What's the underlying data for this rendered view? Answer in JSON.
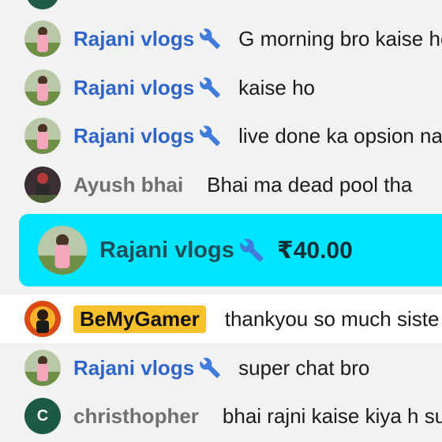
{
  "colors": {
    "member_name": "#2f64c8",
    "superchat_bg": "#00e5ff",
    "badge_bg": "#f7c12c",
    "avatar_letter_bg": "#1c5a44"
  },
  "icons": {
    "moderator": "wrench-icon"
  },
  "messages": [
    {
      "author": "Rajani vlogs",
      "text": "G morning bro kaise ho"
    },
    {
      "author": "Rajani vlogs",
      "text": "kaise ho"
    },
    {
      "author": "Rajani vlogs",
      "text": "live done ka opsion na"
    },
    {
      "author": "Ayush bhai",
      "text": "Bhai ma dead pool tha"
    }
  ],
  "superchat": {
    "author": "Rajani vlogs",
    "amount": "₹40.00"
  },
  "messages_after": [
    {
      "author": "BeMyGamer",
      "text": "thankyou so much siste"
    },
    {
      "author": "Rajani vlogs",
      "text": "super chat bro"
    },
    {
      "author": "christhopher",
      "avatar_letter": "C",
      "text": "bhai rajni kaise kiya h sup"
    }
  ]
}
